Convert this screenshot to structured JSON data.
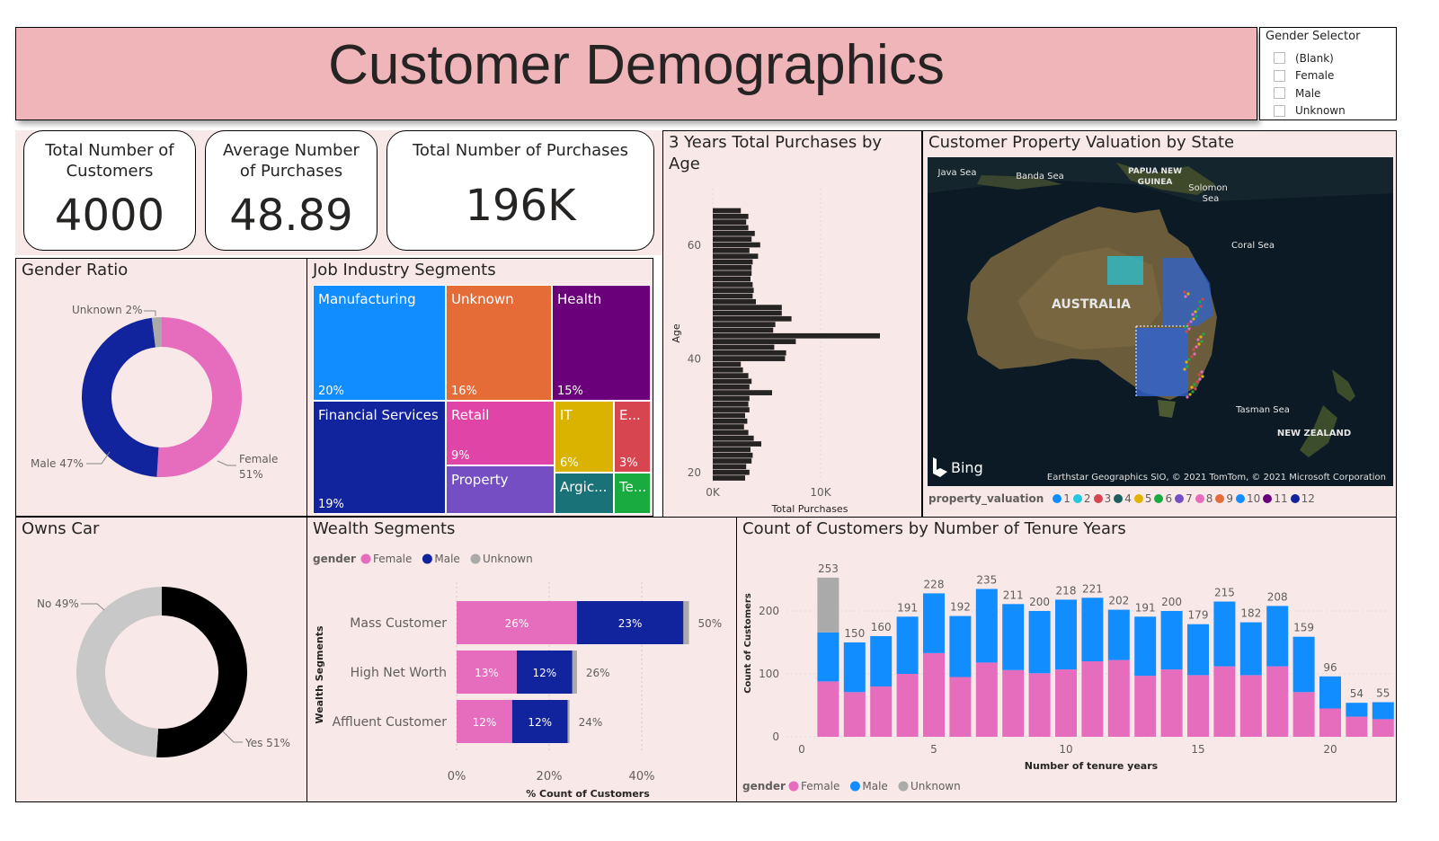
{
  "header": {
    "title": "Customer Demographics"
  },
  "slicer": {
    "title": "Gender Selector",
    "options": [
      "(Blank)",
      "Female",
      "Male",
      "Unknown"
    ]
  },
  "kpis": [
    {
      "label": "Total Number of Customers",
      "value": "4000"
    },
    {
      "label": "Average Number of Purchases",
      "value": "48.89"
    },
    {
      "label": "Total Number of Purchases",
      "value": "196K"
    }
  ],
  "colors": {
    "female": "#e66cbe",
    "male": "#12239e",
    "male_tenure": "#118dff",
    "unknown": "#aaaaaa",
    "panel": "#f9e8e8",
    "header": "#efb5b9",
    "dark": "#252423",
    "no_car": "#c8c8c8"
  },
  "gender_ratio": {
    "title": "Gender Ratio",
    "labels": [
      "Unknown 2%",
      "Male 47%",
      "Female",
      "51%"
    ]
  },
  "owns_car": {
    "title": "Owns Car",
    "labels": [
      "No 49%",
      "Yes 51%"
    ]
  },
  "job_industry": {
    "title": "Job Industry Segments"
  },
  "age_chart": {
    "title1": "3 Years Total Purchases by",
    "title2": "Age",
    "ylabel": "Age",
    "xlabel": "Total Purchases",
    "yticks": [
      "60",
      "40",
      "20"
    ],
    "xticks": [
      "0K",
      "10K"
    ]
  },
  "map": {
    "title": "Customer Property Valuation by State",
    "labels": [
      "Java Sea",
      "Banda Sea",
      "PAPUA NEW",
      "GUINEA",
      "Solomon",
      "Sea",
      "Coral Sea",
      "AUSTRALIA",
      "Tasman Sea",
      "NEW ZEALAND"
    ],
    "bing": "Bing",
    "copyright": "Earthstar Geographics SIO, © 2021 TomTom, © 2021 Microsoft Corporation",
    "legend_title": "property_valuation",
    "legend": [
      {
        "label": "1",
        "color": "#118dff"
      },
      {
        "label": "2",
        "color": "#21c9e0"
      },
      {
        "label": "3",
        "color": "#d64550"
      },
      {
        "label": "4",
        "color": "#1b5e5e"
      },
      {
        "label": "5",
        "color": "#e0b400"
      },
      {
        "label": "6",
        "color": "#1aab40"
      },
      {
        "label": "7",
        "color": "#744ec2"
      },
      {
        "label": "8",
        "color": "#e66cbe"
      },
      {
        "label": "9",
        "color": "#e66c37"
      },
      {
        "label": "10",
        "color": "#118dff"
      },
      {
        "label": "11",
        "color": "#6b007b"
      },
      {
        "label": "12",
        "color": "#12239e"
      }
    ]
  },
  "wealth": {
    "title": "Wealth Segments",
    "legend_title": "gender",
    "legend": [
      "Female",
      "Male",
      "Unknown"
    ],
    "ylabel": "Wealth Segments",
    "xlabel": "% Count of Customers",
    "xticks": [
      "0%",
      "20%",
      "40%"
    ]
  },
  "tenure": {
    "title": "Count of Customers by Number of Tenure Years",
    "ylabel": "Count of Customers",
    "xlabel": "Number of tenure years",
    "yticks": [
      "0",
      "100",
      "200"
    ],
    "xticks": [
      "0",
      "5",
      "10",
      "15",
      "20"
    ],
    "legend_title": "gender",
    "legend": [
      "Female",
      "Male",
      "Unknown"
    ]
  },
  "chart_data": [
    {
      "type": "pie",
      "title": "Gender Ratio",
      "categories": [
        "Female",
        "Male",
        "Unknown"
      ],
      "values": [
        51,
        47,
        2
      ]
    },
    {
      "type": "pie",
      "title": "Owns Car",
      "categories": [
        "Yes",
        "No"
      ],
      "values": [
        51,
        49
      ]
    },
    {
      "type": "table",
      "title": "Job Industry Segments",
      "categories": [
        "Manufacturing",
        "Financial Services",
        "Unknown",
        "Health",
        "Retail",
        "Property",
        "IT",
        "E...",
        "Argic...",
        "Te..."
      ],
      "values": [
        20,
        19,
        16,
        15,
        9,
        null,
        6,
        3,
        null,
        null
      ],
      "percent_labels": [
        "20%",
        "19%",
        "16%",
        "15%",
        "9%",
        "",
        "6%",
        "3%",
        "",
        ""
      ],
      "colors": [
        "#118dff",
        "#12239e",
        "#e66c37",
        "#6b007b",
        "#e044a7",
        "#744ec2",
        "#d9b300",
        "#d64550",
        "#197278",
        "#1aab40"
      ]
    },
    {
      "type": "bar",
      "title": "3 Years Total Purchases by Age",
      "orientation": "horizontal",
      "xlabel": "Total Purchases",
      "ylabel": "Age",
      "ylim": [
        18,
        80
      ],
      "xlim": [
        0,
        15500
      ],
      "x": [
        19,
        20,
        21,
        22,
        23,
        24,
        25,
        26,
        27,
        28,
        29,
        30,
        31,
        32,
        33,
        34,
        35,
        36,
        37,
        38,
        39,
        40,
        41,
        42,
        43,
        44,
        45,
        46,
        47,
        48,
        49,
        50,
        51,
        52,
        53,
        54,
        55,
        56,
        57,
        58,
        59,
        60,
        61,
        62,
        63,
        64,
        65,
        66,
        67,
        68,
        69,
        70
      ],
      "values": [
        3000,
        3400,
        3100,
        3600,
        3700,
        3500,
        4500,
        3800,
        3300,
        2900,
        3200,
        3000,
        3400,
        3300,
        3400,
        5500,
        3400,
        3600,
        3300,
        2800,
        2600,
        6700,
        6800,
        5700,
        7700,
        15500,
        5600,
        5800,
        7300,
        6400,
        6400,
        4000,
        3700,
        3800,
        3700,
        3500,
        3600,
        3600,
        3700,
        4200,
        3400,
        4400,
        3600,
        3900,
        3300,
        3100,
        3300,
        2600,
        0,
        0,
        0,
        0
      ]
    },
    {
      "type": "bar",
      "title": "Wealth Segments",
      "orientation": "horizontal",
      "categories": [
        "Mass Customer",
        "High Net Worth",
        "Affluent Customer"
      ],
      "series": [
        {
          "name": "Female",
          "values": [
            26,
            13,
            12
          ]
        },
        {
          "name": "Male",
          "values": [
            23,
            12,
            12
          ]
        },
        {
          "name": "Unknown",
          "values": [
            1.2,
            1.0,
            0.4
          ]
        }
      ],
      "totals": [
        "50%",
        "26%",
        "24%"
      ],
      "xlabel": "% Count of Customers",
      "ylabel": "Wealth Segments",
      "xlim": [
        0,
        55
      ]
    },
    {
      "type": "bar",
      "title": "Count of Customers by Number of Tenure Years",
      "stacked": true,
      "xlabel": "Number of tenure years",
      "ylabel": "Count of Customers",
      "x": [
        1,
        2,
        3,
        4,
        5,
        6,
        7,
        8,
        9,
        10,
        11,
        12,
        13,
        14,
        15,
        16,
        17,
        18,
        19,
        20,
        21,
        22
      ],
      "series": [
        {
          "name": "Female",
          "values": [
            88,
            71,
            80,
            100,
            133,
            95,
            118,
            106,
            101,
            107,
            120,
            122,
            97,
            107,
            98,
            112,
            98,
            112,
            71,
            45,
            32,
            28
          ]
        },
        {
          "name": "Male",
          "values": [
            78,
            79,
            80,
            91,
            95,
            97,
            117,
            105,
            99,
            111,
            101,
            80,
            94,
            93,
            81,
            103,
            84,
            96,
            88,
            51,
            22,
            27
          ]
        },
        {
          "name": "Unknown",
          "values": [
            87,
            0,
            0,
            0,
            0,
            0,
            0,
            0,
            0,
            0,
            0,
            0,
            0,
            0,
            0,
            0,
            0,
            0,
            0,
            0,
            0,
            0
          ]
        }
      ],
      "totals": [
        253,
        150,
        160,
        191,
        228,
        192,
        235,
        211,
        200,
        218,
        221,
        202,
        191,
        200,
        179,
        215,
        182,
        208,
        159,
        96,
        54,
        55
      ],
      "ylim": [
        0,
        270
      ]
    }
  ]
}
